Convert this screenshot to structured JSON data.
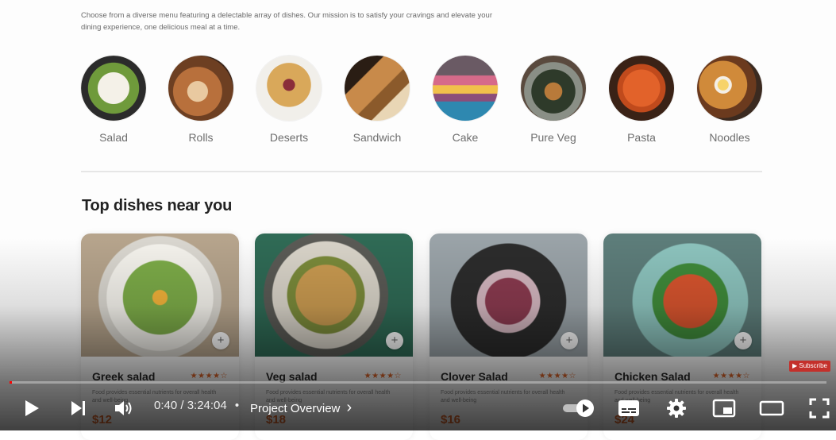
{
  "menu": {
    "intro_text": "Choose from a diverse menu featuring a delectable array of dishes. Our mission is to satisfy your cravings and elevate your dining experience, one delicious meal at a time.",
    "categories": [
      {
        "label": "Salad",
        "color": "#6f9a3b"
      },
      {
        "label": "Rolls",
        "color": "#b8703c"
      },
      {
        "label": "Deserts",
        "color": "#c89a5a"
      },
      {
        "label": "Sandwich",
        "color": "#a8743e"
      },
      {
        "label": "Cake",
        "color": "#4f8fb0"
      },
      {
        "label": "Pure Veg",
        "color": "#4c5a48"
      },
      {
        "label": "Pasta",
        "color": "#d8582a"
      },
      {
        "label": "Noodles",
        "color": "#b86a2e"
      }
    ]
  },
  "top_dishes": {
    "title": "Top dishes near you",
    "items": [
      {
        "name": "Greek salad",
        "rating": "★★★★☆",
        "desc": "Food provides essential nutrients for overall health and well-being",
        "price": "$12",
        "color": "#7cab48"
      },
      {
        "name": "Veg salad",
        "rating": "★★★★☆",
        "desc": "Food provides essential nutrients for overall health and well-being",
        "price": "$18",
        "color": "#c99a50"
      },
      {
        "name": "Clover Salad",
        "rating": "★★★★☆",
        "desc": "Food provides essential nutrients for overall health and well-being",
        "price": "$16",
        "color": "#8a3a4f"
      },
      {
        "name": "Chicken Salad",
        "rating": "★★★★☆",
        "desc": "Food provides essential nutrients for overall health and well-being",
        "price": "$24",
        "color": "#d7542e"
      }
    ],
    "add_label": "+"
  },
  "player": {
    "time": "0:40 / 3:24:04",
    "separator": "•",
    "chapter": "Project Overview",
    "chapter_chevron": "›",
    "subscribe_label": "Subscribe",
    "progress_fraction": 0.003,
    "accent": "#ff0000"
  }
}
